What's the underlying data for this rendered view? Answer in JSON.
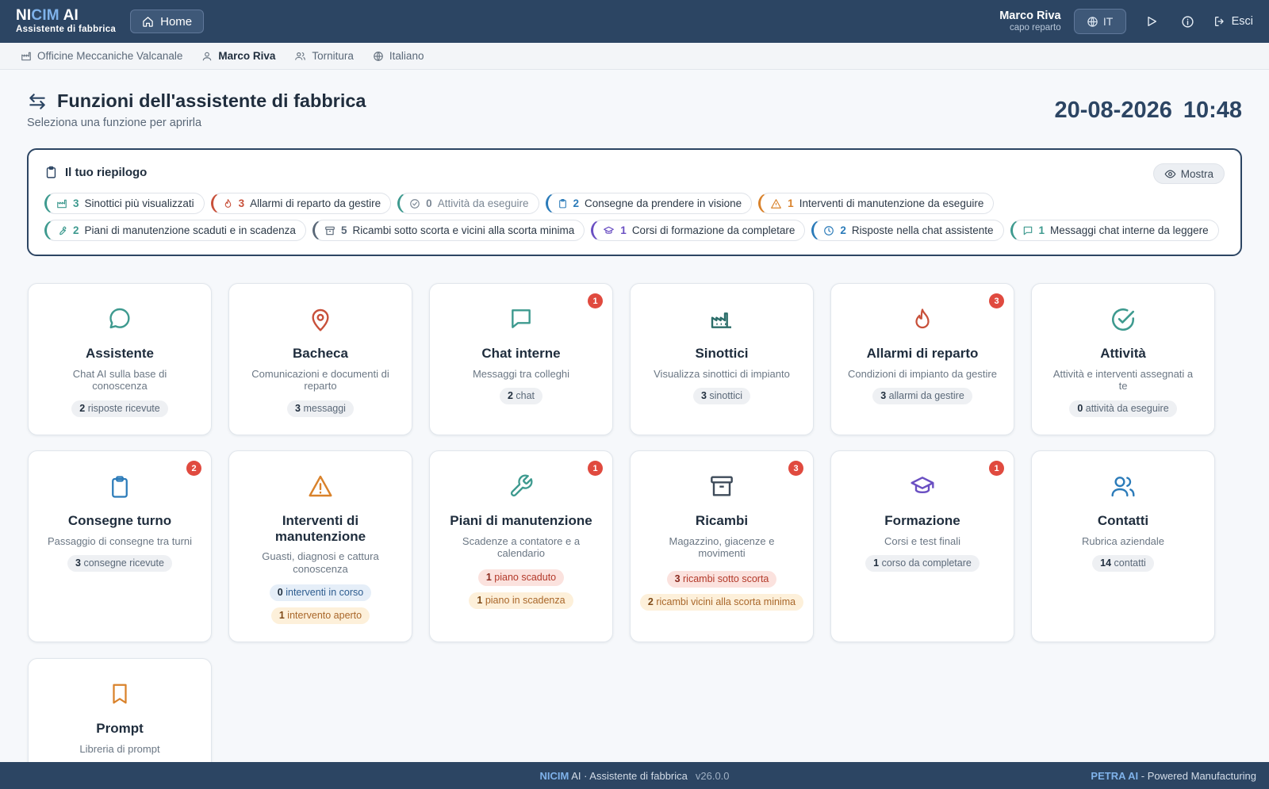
{
  "topbar": {
    "brand_a": "NI",
    "brand_b": "CIM",
    "brand_c": " AI",
    "brand_sub": "Assistente di fabbrica",
    "home_label": "Home",
    "user_name": "Marco Riva",
    "user_role": "capo reparto",
    "lang_label": "IT",
    "exit_label": "Esci"
  },
  "context": {
    "company": "Officine Meccaniche Valcanale",
    "user": "Marco Riva",
    "department": "Tornitura",
    "language": "Italiano"
  },
  "header": {
    "title": "Funzioni dell'assistente di fabbrica",
    "subtitle": "Seleziona una funzione per aprirla",
    "date": "20-08-2026",
    "time": "10:48"
  },
  "summary": {
    "title": "Il tuo riepilogo",
    "show_label": "Mostra",
    "row1": [
      {
        "n": "3",
        "label": "Sinottici più visualizzati",
        "color": "#3e9a8f",
        "icon": "factory-icon"
      },
      {
        "n": "3",
        "label": "Allarmi di reparto da gestire",
        "color": "#c8503a",
        "icon": "flame-icon"
      },
      {
        "n": "0",
        "label": "Attività da eseguire",
        "color": "#3e9a8f",
        "icon": "check-circle-icon"
      },
      {
        "n": "2",
        "label": "Consegne da prendere in visione",
        "color": "#2b7bb9",
        "icon": "clipboard-icon"
      },
      {
        "n": "1",
        "label": "Interventi di manutenzione da eseguire",
        "color": "#d9822b",
        "icon": "warning-icon"
      }
    ],
    "row2": [
      {
        "n": "2",
        "label": "Piani di manutenzione scaduti e in scadenza",
        "color": "#3e9a8f",
        "icon": "wrench-icon"
      },
      {
        "n": "5",
        "label": "Ricambi sotto scorta e vicini alla scorta minima",
        "color": "#5a6878",
        "icon": "box-icon"
      },
      {
        "n": "1",
        "label": "Corsi di formazione da completare",
        "color": "#6a4fc2",
        "icon": "graduation-cap-icon"
      },
      {
        "n": "2",
        "label": "Risposte nella chat assistente",
        "color": "#2b7bb9",
        "icon": "clock-icon"
      },
      {
        "n": "1",
        "label": "Messaggi chat interne da leggere",
        "color": "#3e9a8f",
        "icon": "message-icon"
      }
    ]
  },
  "cards": {
    "assistente": {
      "title": "Assistente",
      "desc": "Chat AI sulla base di conoscenza",
      "pill_n": "2",
      "pill_t": " risposte ricevute"
    },
    "bacheca": {
      "title": "Bacheca",
      "desc": "Comunicazioni e documenti di reparto",
      "pill_n": "3",
      "pill_t": " messaggi"
    },
    "chat": {
      "title": "Chat interne",
      "desc": "Messaggi tra colleghi",
      "pill_n": "2",
      "pill_t": " chat",
      "badge": "1"
    },
    "sinottici": {
      "title": "Sinottici",
      "desc": "Visualizza sinottici di impianto",
      "pill_n": "3",
      "pill_t": " sinottici"
    },
    "allarmi": {
      "title": "Allarmi di reparto",
      "desc": "Condizioni di impianto da gestire",
      "pill_n": "3",
      "pill_t": " allarmi da gestire",
      "badge": "3"
    },
    "attivita": {
      "title": "Attività",
      "desc": "Attività e interventi assegnati a te",
      "pill_n": "0",
      "pill_t": " attività da eseguire"
    },
    "consegne": {
      "title": "Consegne turno",
      "desc": "Passaggio di consegne tra turni",
      "pill_n": "3",
      "pill_t": " consegne ricevute",
      "badge": "2"
    },
    "interventi": {
      "title": "Interventi di manutenzione",
      "desc": "Guasti, diagnosi e cattura conoscenza",
      "pill1_n": "0",
      "pill1_t": " interventi in corso",
      "pill2_n": "1",
      "pill2_t": " intervento aperto"
    },
    "piani": {
      "title": "Piani di manutenzione",
      "desc": "Scadenze a contatore e a calendario",
      "pill1_n": "1",
      "pill1_t": " piano scaduto",
      "pill2_n": "1",
      "pill2_t": " piano in scadenza",
      "badge": "1"
    },
    "ricambi": {
      "title": "Ricambi",
      "desc": "Magazzino, giacenze e movimenti",
      "pill1_n": "3",
      "pill1_t": " ricambi sotto scorta",
      "pill2_n": "2",
      "pill2_t": " ricambi vicini alla scorta minima",
      "badge": "3"
    },
    "formazione": {
      "title": "Formazione",
      "desc": "Corsi e test finali",
      "pill_n": "1",
      "pill_t": " corso da completare",
      "badge": "1"
    },
    "contatti": {
      "title": "Contatti",
      "desc": "Rubrica aziendale",
      "pill_n": "14",
      "pill_t": " contatti"
    },
    "prompt": {
      "title": "Prompt",
      "desc": "Libreria di prompt"
    }
  },
  "footer": {
    "brand_hl": "NICIM",
    "brand_rest": " AI · Assistente di fabbrica",
    "version": "v26.0.0",
    "right_hl": "PETRA AI",
    "right_rest": " - Powered Manufacturing"
  },
  "colors": {
    "topbar": "#2c4563",
    "accent": "#7fb2ea",
    "badge": "#e04a3f",
    "teal": "#3e9a8f",
    "red": "#c8503a",
    "blue": "#2b7bb9",
    "orange": "#d9822b",
    "purple": "#6a4fc2"
  }
}
